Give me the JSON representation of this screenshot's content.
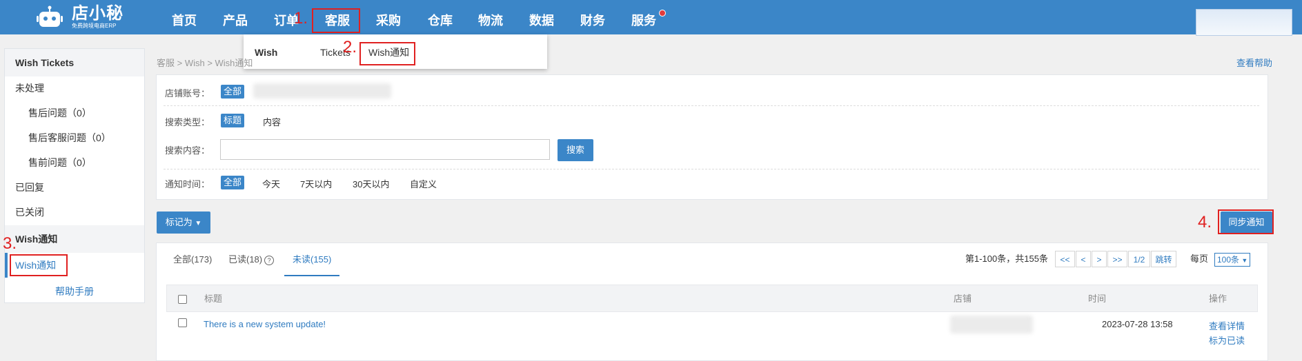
{
  "brand": {
    "name": "店小秘",
    "tagline": "免费跨境电商ERP"
  },
  "nav": {
    "items": [
      "首页",
      "产品",
      "订单",
      "客服",
      "采购",
      "仓库",
      "物流",
      "数据",
      "财务",
      "服务"
    ]
  },
  "annotations": {
    "step1": "1.",
    "step2": "2.",
    "step3": "3.",
    "step4": "4."
  },
  "dropdown": {
    "section": "Wish",
    "items": [
      "Tickets",
      "Wish通知"
    ]
  },
  "sidebar": {
    "tickets_header": "Wish Tickets",
    "pending": "未处理",
    "sub_items": [
      "售后问题（0）",
      "售后客服问题（0）",
      "售前问题（0）"
    ],
    "replied": "已回复",
    "closed": "已关闭",
    "notice_header": "Wish通知",
    "notice_item": "Wish通知",
    "help": "帮助手册"
  },
  "breadcrumb": "客服 > Wish > Wish通知",
  "help_link": "查看帮助",
  "filters": {
    "store_label": "店铺账号：",
    "store_all": "全部",
    "type_label": "搜索类型：",
    "type_options": [
      "标题",
      "内容"
    ],
    "content_label": "搜索内容：",
    "search_value": "",
    "search_button": "搜索",
    "time_label": "通知时间：",
    "time_options": [
      "全部",
      "今天",
      "7天以内",
      "30天以内",
      "自定义"
    ]
  },
  "actions": {
    "mark_as": "标记为",
    "sync": "同步通知"
  },
  "tabs": {
    "all": "全部(173)",
    "read": "已读(18)",
    "read_help": "?",
    "unread": "未读(155)"
  },
  "pagination": {
    "summary": "第1-100条，共155条",
    "first": "<<",
    "prev": "<",
    "next": ">",
    "last": ">>",
    "page": "1/2",
    "jump": "跳转",
    "per_page_label": "每页",
    "per_page": "100条"
  },
  "table": {
    "columns": [
      "标题",
      "店铺",
      "时间",
      "操作"
    ],
    "rows": [
      {
        "title": "There is a new system update!",
        "time": "2023-07-28 13:58",
        "view": "查看详情",
        "mark_read": "标为已读"
      }
    ]
  },
  "colors": {
    "primary": "#3b86c8",
    "annotation_red": "#e02020"
  }
}
